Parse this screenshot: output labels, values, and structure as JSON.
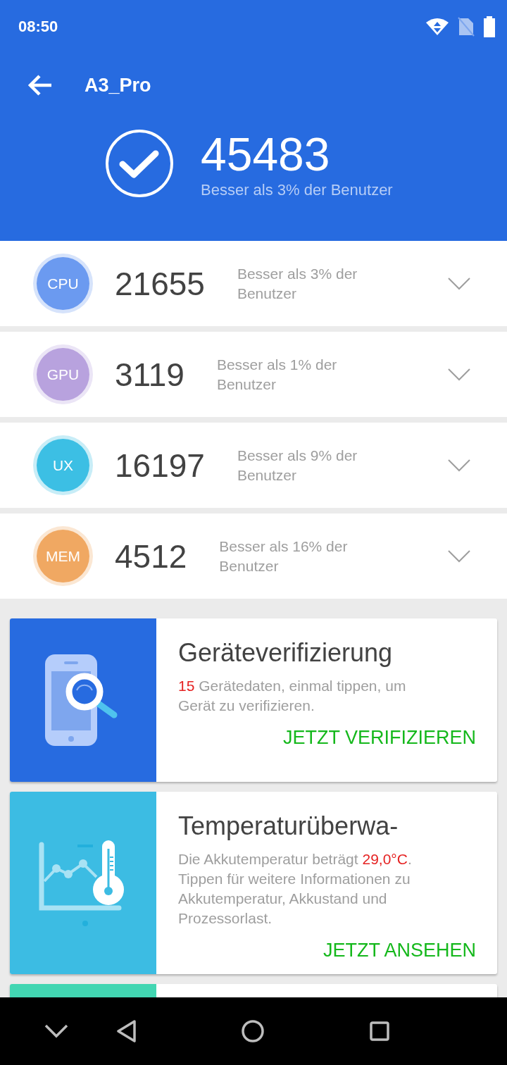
{
  "status_bar": {
    "time": "08:50"
  },
  "header": {
    "title": "A3_Pro",
    "total_score": "45483",
    "percentile": "Besser als 3% der Benutzer"
  },
  "scores": [
    {
      "label": "CPU",
      "score": "21655",
      "percentile": "Besser als 3% der Benutzer",
      "color": "#6b9af0"
    },
    {
      "label": "GPU",
      "score": "3119",
      "percentile": "Besser als 1% der Benutzer",
      "color": "#b8a2de"
    },
    {
      "label": "UX",
      "score": "16197",
      "percentile": "Besser als 9% der Benutzer",
      "color": "#3cbfe4"
    },
    {
      "label": "MEM",
      "score": "4512",
      "percentile": "Besser als 16% der Benutzer",
      "color": "#f0a862"
    }
  ],
  "cards": [
    {
      "kind": "verify",
      "color": "#276be0",
      "title": "Geräteverifizierung",
      "highlight": "15",
      "text_after": " Gerätedaten, einmal tippen, um Gerät zu verifizieren.",
      "action": "JETZT VERIFIZIEREN"
    },
    {
      "kind": "temperature",
      "color": "#3cbce3",
      "title": "Temperaturüberwa-",
      "text_before": "Die Akkutemperatur beträgt ",
      "highlight": "29,0°C",
      "text_after": ". Tippen für weitere Informationen zu Akkutemperatur, Akkustand und Prozessorlast.",
      "action": "JETZT ANSEHEN"
    },
    {
      "kind": "stress",
      "color": "#42d6b2"
    }
  ]
}
